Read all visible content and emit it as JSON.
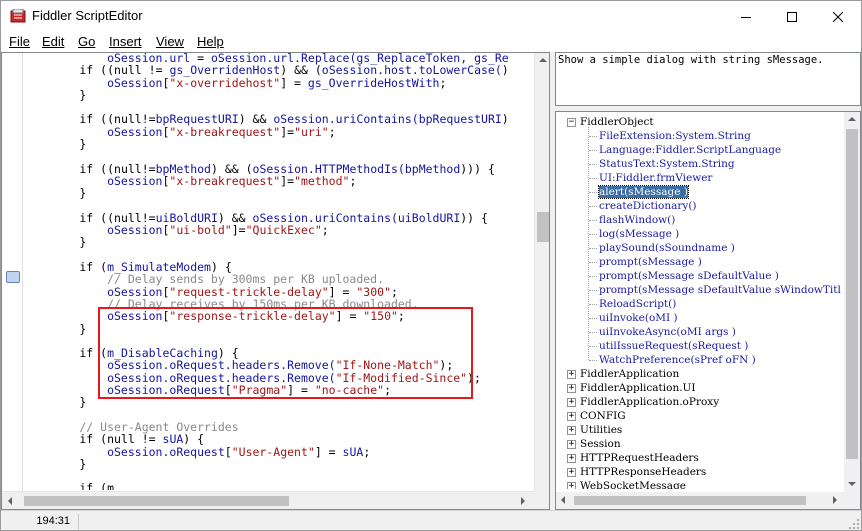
{
  "window": {
    "title": "Fiddler ScriptEditor",
    "controls": {
      "minimize": "minimize-icon",
      "maximize": "maximize-icon",
      "close": "close-icon"
    }
  },
  "menu": [
    "File",
    "Edit",
    "Go",
    "Insert",
    "View",
    "Help"
  ],
  "code_lines": [
    [
      [
        "id",
        "            oSession."
      ],
      [
        "id",
        "url"
      ],
      [
        "p",
        " = "
      ],
      [
        "id",
        "oSession.url.Replace(gs_ReplaceToken, gs_Re"
      ]
    ],
    [
      [
        "kw",
        "        if "
      ],
      [
        "p",
        "(("
      ],
      [
        "kw",
        "null"
      ],
      [
        "p",
        " != "
      ],
      [
        "id",
        "gs_OverridenHost"
      ],
      [
        "p",
        ") && ("
      ],
      [
        "id",
        "oSession.host.toLowerCase("
      ],
      [
        "p",
        ")"
      ]
    ],
    [
      [
        "id",
        "            oSession"
      ],
      [
        "p",
        "["
      ],
      [
        "str",
        "\"x-overridehost\""
      ],
      [
        "p",
        "] = "
      ],
      [
        "id",
        "gs_OverrideHostWith"
      ],
      [
        "p",
        ";"
      ]
    ],
    [
      [
        "p",
        "        }"
      ]
    ],
    [
      [
        "p",
        ""
      ]
    ],
    [
      [
        "kw",
        "        if "
      ],
      [
        "p",
        "(("
      ],
      [
        "kw",
        "null"
      ],
      [
        "p",
        "!="
      ],
      [
        "id",
        "bpRequestURI"
      ],
      [
        "p",
        ") && "
      ],
      [
        "id",
        "oSession.uriContains(bpRequestURI"
      ],
      [
        "p",
        ")"
      ]
    ],
    [
      [
        "id",
        "            oSession"
      ],
      [
        "p",
        "["
      ],
      [
        "str",
        "\"x-breakrequest\""
      ],
      [
        "p",
        "]="
      ],
      [
        "str",
        "\"uri\""
      ],
      [
        "p",
        ";"
      ]
    ],
    [
      [
        "p",
        "        }"
      ]
    ],
    [
      [
        "p",
        ""
      ]
    ],
    [
      [
        "kw",
        "        if "
      ],
      [
        "p",
        "(("
      ],
      [
        "kw",
        "null"
      ],
      [
        "p",
        "!="
      ],
      [
        "id",
        "bpMethod"
      ],
      [
        "p",
        ") && ("
      ],
      [
        "id",
        "oSession.HTTPMethodIs(bpMethod"
      ],
      [
        "p",
        "))) {"
      ]
    ],
    [
      [
        "id",
        "            oSession"
      ],
      [
        "p",
        "["
      ],
      [
        "str",
        "\"x-breakrequest\""
      ],
      [
        "p",
        "]="
      ],
      [
        "str",
        "\"method\""
      ],
      [
        "p",
        ";"
      ]
    ],
    [
      [
        "p",
        "        }"
      ]
    ],
    [
      [
        "p",
        ""
      ]
    ],
    [
      [
        "kw",
        "        if "
      ],
      [
        "p",
        "(("
      ],
      [
        "kw",
        "null"
      ],
      [
        "p",
        "!="
      ],
      [
        "id",
        "uiBoldURI"
      ],
      [
        "p",
        ") && "
      ],
      [
        "id",
        "oSession.uriContains(uiBoldURI"
      ],
      [
        "p",
        ")) {"
      ]
    ],
    [
      [
        "id",
        "            oSession"
      ],
      [
        "p",
        "["
      ],
      [
        "str",
        "\"ui-bold\""
      ],
      [
        "p",
        "]="
      ],
      [
        "str",
        "\"QuickExec\""
      ],
      [
        "p",
        ";"
      ]
    ],
    [
      [
        "p",
        "        }"
      ]
    ],
    [
      [
        "p",
        ""
      ]
    ],
    [
      [
        "kw",
        "        if "
      ],
      [
        "p",
        "("
      ],
      [
        "id",
        "m_SimulateModem"
      ],
      [
        "p",
        ") {"
      ]
    ],
    [
      [
        "cm",
        "            // Delay sends by 300ms per KB uploaded."
      ]
    ],
    [
      [
        "id",
        "            oSession"
      ],
      [
        "p",
        "["
      ],
      [
        "str",
        "\"request-trickle-delay\""
      ],
      [
        "p",
        "] = "
      ],
      [
        "str",
        "\"300\""
      ],
      [
        "p",
        ";"
      ]
    ],
    [
      [
        "cm",
        "            // Delay receives by 150ms per KB downloaded."
      ]
    ],
    [
      [
        "id",
        "            oSession"
      ],
      [
        "p",
        "["
      ],
      [
        "str",
        "\"response-trickle-delay\""
      ],
      [
        "p",
        "] = "
      ],
      [
        "str",
        "\"150\""
      ],
      [
        "p",
        ";"
      ]
    ],
    [
      [
        "p",
        "        }"
      ]
    ],
    [
      [
        "p",
        ""
      ]
    ],
    [
      [
        "kw",
        "        if "
      ],
      [
        "p",
        "("
      ],
      [
        "id",
        "m_DisableCaching"
      ],
      [
        "p",
        ") {"
      ]
    ],
    [
      [
        "id",
        "            oSession.oRequest.headers.Remove("
      ],
      [
        "str",
        "\"If-None-Match\""
      ],
      [
        "p",
        ");"
      ]
    ],
    [
      [
        "id",
        "            oSession.oRequest.headers.Remove("
      ],
      [
        "str",
        "\"If-Modified-Since\""
      ],
      [
        "p",
        ");"
      ]
    ],
    [
      [
        "id",
        "            oSession.oRequest"
      ],
      [
        "p",
        "["
      ],
      [
        "str",
        "\"Pragma\""
      ],
      [
        "p",
        "] = "
      ],
      [
        "str",
        "\"no-cache\""
      ],
      [
        "p",
        ";"
      ]
    ],
    [
      [
        "p",
        "        }"
      ]
    ],
    [
      [
        "p",
        ""
      ]
    ],
    [
      [
        "cm",
        "        // User-Agent Overrides"
      ]
    ],
    [
      [
        "kw",
        "        if "
      ],
      [
        "p",
        "("
      ],
      [
        "kw",
        "null"
      ],
      [
        "p",
        " != "
      ],
      [
        "id",
        "sUA"
      ],
      [
        "p",
        ") {"
      ]
    ],
    [
      [
        "id",
        "            oSession.oRequest"
      ],
      [
        "p",
        "["
      ],
      [
        "str",
        "\"User-Agent\""
      ],
      [
        "p",
        "] = "
      ],
      [
        "id",
        "sUA"
      ],
      [
        "p",
        ";"
      ]
    ],
    [
      [
        "p",
        "        }"
      ]
    ],
    [
      [
        "p",
        ""
      ]
    ],
    [
      [
        "kw",
        "        if "
      ],
      [
        "p",
        "(m_"
      ]
    ]
  ],
  "description": "Show a simple dialog with string sMessage.",
  "tree": {
    "root_expanded": "FiddlerObject",
    "children": [
      "FileExtension:System.String",
      "Language:Fiddler.ScriptLanguage",
      "StatusText:System.String",
      "UI:Fiddler.frmViewer",
      "alert(sMessage )",
      "createDictionary()",
      "flashWindow()",
      "log(sMessage )",
      "playSound(sSoundname )",
      "prompt(sMessage )",
      "prompt(sMessage sDefaultValue )",
      "prompt(sMessage sDefaultValue sWindowTitl",
      "ReloadScript()",
      "uiInvoke(oMI )",
      "uiInvokeAsync(oMI args )",
      "utilIssueRequest(sRequest )",
      "WatchPreference(sPref oFN )"
    ],
    "selected_child": "alert(sMessage )",
    "collapsed": [
      "FiddlerApplication",
      "FiddlerApplication.UI",
      "FiddlerApplication.oProxy",
      "CONFIG",
      "Utilities",
      "Session",
      "HTTPRequestHeaders",
      "HTTPResponseHeaders",
      "WebSocketMessage"
    ]
  },
  "status": {
    "position": "194:31"
  },
  "colors": {
    "highlight_box": "#e81818",
    "selection": "#3a6ea5",
    "identifier": "#1414a0",
    "string": "#a31515",
    "comment": "#8a8a8a"
  }
}
